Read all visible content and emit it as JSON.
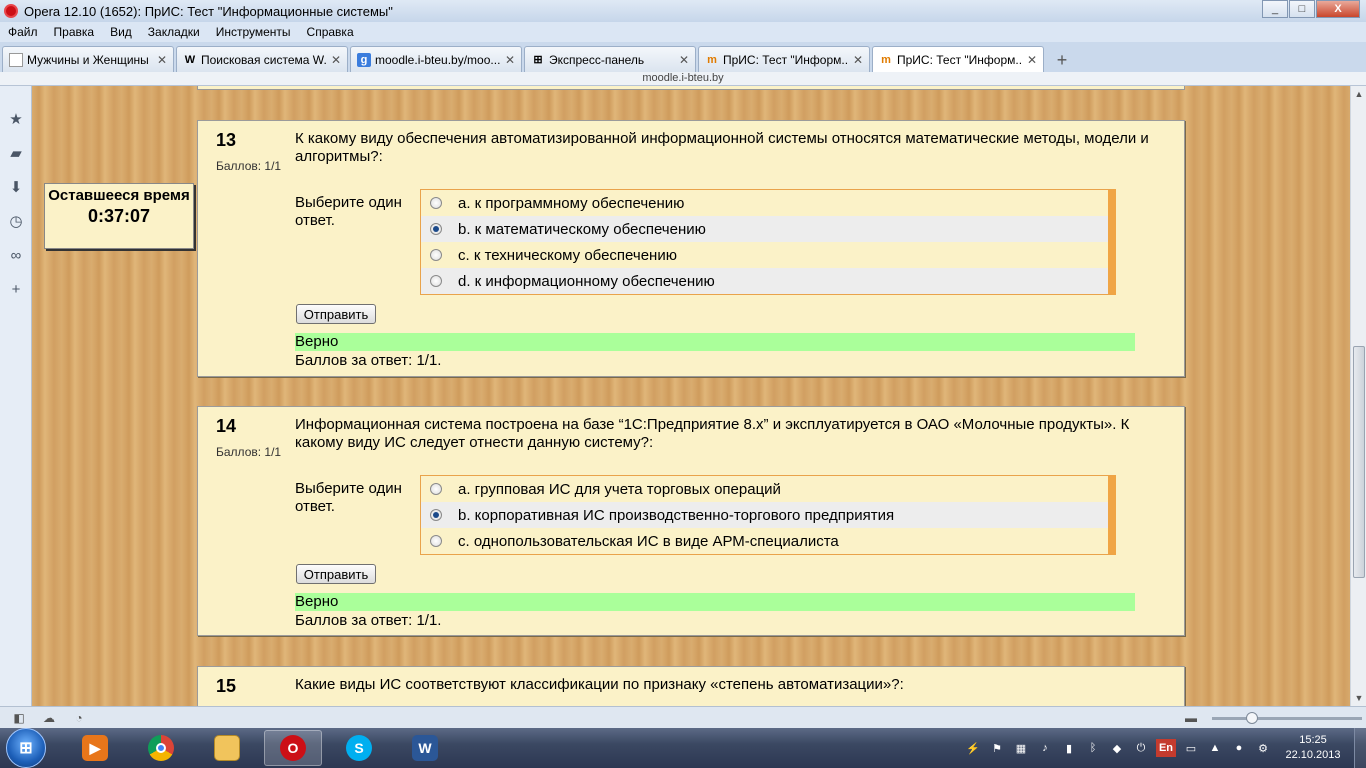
{
  "window": {
    "title": "Opera 12.10 (1652): ПрИС: Тест \"Информационные системы\"",
    "controls": [
      "_",
      "□",
      "X"
    ]
  },
  "menu": [
    "Файл",
    "Правка",
    "Вид",
    "Закладки",
    "Инструменты",
    "Справка"
  ],
  "tabs": [
    {
      "label": "Мужчины и Женщины",
      "icon": "page-icon",
      "favicon_text": ""
    },
    {
      "label": "Поисковая система W...",
      "icon": "wikipedia-icon",
      "favicon_text": "W"
    },
    {
      "label": "moodle.i-bteu.by/moo...",
      "icon": "google-icon",
      "favicon_text": "g"
    },
    {
      "label": "Экспресс-панель",
      "icon": "speed-dial-icon",
      "favicon_text": "⊞"
    },
    {
      "label": "ПрИС: Тест \"Информ...",
      "icon": "moodle-icon",
      "favicon_text": "m"
    },
    {
      "label": "ПрИС: Тест \"Информ...",
      "icon": "moodle-icon",
      "favicon_text": "m",
      "active": true
    }
  ],
  "address": "moodle.i-bteu.by",
  "timer": {
    "label": "Оставшееся время",
    "value": "0:37:07"
  },
  "questions": [
    {
      "number": "13",
      "grade": "Баллов: 1/1",
      "text": "К какому виду обеспечения автоматизированной информационной системы относятся математические методы, модели и алгоритмы?:",
      "prompt": "Выберите один ответ.",
      "options": [
        {
          "label": "a. к программному обеспечению",
          "checked": false
        },
        {
          "label": "b. к математическому обеспечению",
          "checked": true
        },
        {
          "label": "c. к техническому обеспечению",
          "checked": false
        },
        {
          "label": "d. к информационному обеспечению",
          "checked": false
        }
      ],
      "submit": "Отправить",
      "feedback": "Верно",
      "points": "Баллов за ответ: 1/1."
    },
    {
      "number": "14",
      "grade": "Баллов: 1/1",
      "text": "Информационная система построена на базе “1С:Предприятие 8.x” и эксплуатируется в ОАО «Молочные продукты». К какому виду ИС следует отнести данную систему?:",
      "prompt": "Выберите один ответ.",
      "options": [
        {
          "label": "a. групповая ИС для учета торговых операций",
          "checked": false
        },
        {
          "label": "b. корпоративная ИС производственно-торгового предприятия",
          "checked": true
        },
        {
          "label": "c. однопользовательская ИС в виде АРМ-специалиста",
          "checked": false
        }
      ],
      "submit": "Отправить",
      "feedback": "Верно",
      "points": "Баллов за ответ: 1/1."
    },
    {
      "number": "15",
      "text": "Какие виды ИС соответствуют классификации по признаку «степень автоматизации»?:"
    }
  ],
  "taskbar": {
    "start_icon": "windows-start-icon",
    "apps": [
      "media-player-icon",
      "chrome-icon",
      "explorer-icon",
      "opera-icon",
      "skype-icon",
      "word-icon"
    ],
    "tray_lang": "En",
    "time": "15:25",
    "date": "22.10.2013"
  },
  "colors": {
    "panel": "#fbf2c8",
    "correct": "#aaff9a",
    "accent": "#f0a545"
  }
}
